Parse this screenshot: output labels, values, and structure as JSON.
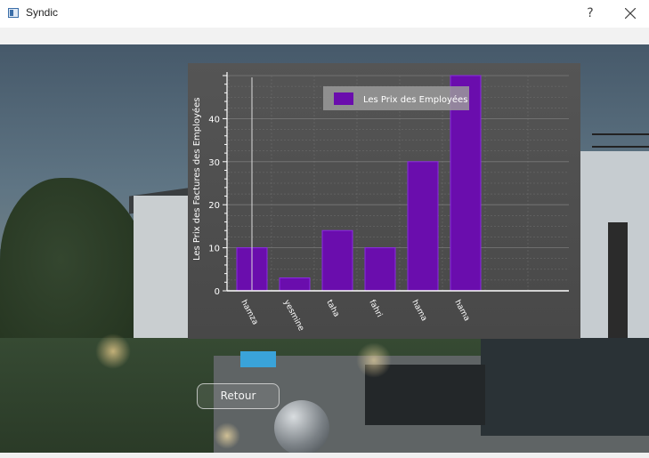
{
  "window": {
    "title": "Syndic",
    "help_label": "?",
    "close_icon": "close-icon",
    "app_icon": "window-app-icon"
  },
  "actions": {
    "back_label": "Retour"
  },
  "colors": {
    "bar": "#6a0dad",
    "bar_border": "#8a2be2",
    "axis": "#ffffff",
    "grid": "#7a7a7a"
  },
  "chart_data": {
    "type": "bar",
    "categories": [
      "hamza",
      "yesmine",
      "taha",
      "fahri",
      "hama",
      "hama"
    ],
    "series": [
      {
        "name": "Les Prix des Employées",
        "values": [
          10,
          3,
          14,
          10,
          30,
          50
        ]
      }
    ],
    "ylabel": "Les Prix des Factures des Employées",
    "xlabel": "",
    "ylim": [
      0,
      50
    ],
    "yticks": [
      0,
      10,
      20,
      30,
      40
    ],
    "grid": true,
    "legend_position": "top-center"
  }
}
